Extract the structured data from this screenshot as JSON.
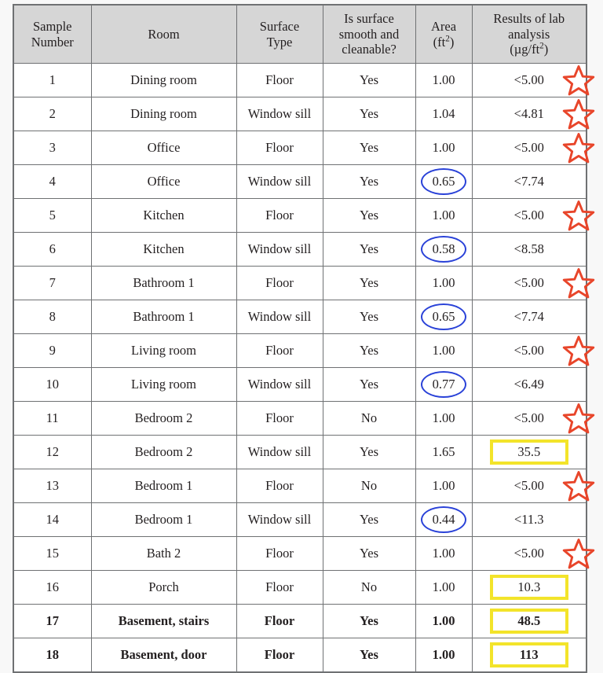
{
  "table": {
    "columns": [
      {
        "key": "sample",
        "label_lines": [
          "Sample",
          "Number"
        ]
      },
      {
        "key": "room",
        "label_lines": [
          "Room"
        ]
      },
      {
        "key": "surface",
        "label_lines": [
          "Surface",
          "Type"
        ]
      },
      {
        "key": "smooth",
        "label_lines": [
          "Is surface",
          "smooth and",
          "cleanable?"
        ]
      },
      {
        "key": "area",
        "label_lines": [
          "Area",
          "(ft2)"
        ],
        "unit_html": "(ft<sup>2</sup>)"
      },
      {
        "key": "lab",
        "label_lines": [
          "Results of lab",
          "analysis",
          "(µg/ft2)"
        ],
        "unit_html": "(µg/ft<sup>2</sup>)"
      }
    ],
    "rows": [
      {
        "sample": "1",
        "room": "Dining room",
        "surface": "Floor",
        "smooth": "Yes",
        "area": "1.00",
        "lab": "<5.00",
        "area_circled": false,
        "lab_boxed": false,
        "lab_starred": true,
        "bold": false
      },
      {
        "sample": "2",
        "room": "Dining room",
        "surface": "Window sill",
        "smooth": "Yes",
        "area": "1.04",
        "lab": "<4.81",
        "area_circled": false,
        "lab_boxed": false,
        "lab_starred": true,
        "bold": false
      },
      {
        "sample": "3",
        "room": "Office",
        "surface": "Floor",
        "smooth": "Yes",
        "area": "1.00",
        "lab": "<5.00",
        "area_circled": false,
        "lab_boxed": false,
        "lab_starred": true,
        "bold": false
      },
      {
        "sample": "4",
        "room": "Office",
        "surface": "Window sill",
        "smooth": "Yes",
        "area": "0.65",
        "lab": "<7.74",
        "area_circled": true,
        "lab_boxed": false,
        "lab_starred": false,
        "bold": false
      },
      {
        "sample": "5",
        "room": "Kitchen",
        "surface": "Floor",
        "smooth": "Yes",
        "area": "1.00",
        "lab": "<5.00",
        "area_circled": false,
        "lab_boxed": false,
        "lab_starred": true,
        "bold": false
      },
      {
        "sample": "6",
        "room": "Kitchen",
        "surface": "Window sill",
        "smooth": "Yes",
        "area": "0.58",
        "lab": "<8.58",
        "area_circled": true,
        "lab_boxed": false,
        "lab_starred": false,
        "bold": false
      },
      {
        "sample": "7",
        "room": "Bathroom 1",
        "surface": "Floor",
        "smooth": "Yes",
        "area": "1.00",
        "lab": "<5.00",
        "area_circled": false,
        "lab_boxed": false,
        "lab_starred": true,
        "bold": false
      },
      {
        "sample": "8",
        "room": "Bathroom 1",
        "surface": "Window sill",
        "smooth": "Yes",
        "area": "0.65",
        "lab": "<7.74",
        "area_circled": true,
        "lab_boxed": false,
        "lab_starred": false,
        "bold": false
      },
      {
        "sample": "9",
        "room": "Living room",
        "surface": "Floor",
        "smooth": "Yes",
        "area": "1.00",
        "lab": "<5.00",
        "area_circled": false,
        "lab_boxed": false,
        "lab_starred": true,
        "bold": false
      },
      {
        "sample": "10",
        "room": "Living room",
        "surface": "Window sill",
        "smooth": "Yes",
        "area": "0.77",
        "lab": "<6.49",
        "area_circled": true,
        "lab_boxed": false,
        "lab_starred": false,
        "bold": false
      },
      {
        "sample": "11",
        "room": "Bedroom 2",
        "surface": "Floor",
        "smooth": "No",
        "area": "1.00",
        "lab": "<5.00",
        "area_circled": false,
        "lab_boxed": false,
        "lab_starred": true,
        "bold": false
      },
      {
        "sample": "12",
        "room": "Bedroom 2",
        "surface": "Window sill",
        "smooth": "Yes",
        "area": "1.65",
        "lab": "35.5",
        "area_circled": false,
        "lab_boxed": true,
        "lab_starred": false,
        "bold": false
      },
      {
        "sample": "13",
        "room": "Bedroom 1",
        "surface": "Floor",
        "smooth": "No",
        "area": "1.00",
        "lab": "<5.00",
        "area_circled": false,
        "lab_boxed": false,
        "lab_starred": true,
        "bold": false
      },
      {
        "sample": "14",
        "room": "Bedroom 1",
        "surface": "Window sill",
        "smooth": "Yes",
        "area": "0.44",
        "lab": "<11.3",
        "area_circled": true,
        "lab_boxed": false,
        "lab_starred": false,
        "bold": false
      },
      {
        "sample": "15",
        "room": "Bath 2",
        "surface": "Floor",
        "smooth": "Yes",
        "area": "1.00",
        "lab": "<5.00",
        "area_circled": false,
        "lab_boxed": false,
        "lab_starred": true,
        "bold": false
      },
      {
        "sample": "16",
        "room": "Porch",
        "surface": "Floor",
        "smooth": "No",
        "area": "1.00",
        "lab": "10.3",
        "area_circled": false,
        "lab_boxed": true,
        "lab_starred": false,
        "bold": false
      },
      {
        "sample": "17",
        "room": "Basement, stairs",
        "surface": "Floor",
        "smooth": "Yes",
        "area": "1.00",
        "lab": "48.5",
        "area_circled": false,
        "lab_boxed": true,
        "lab_starred": false,
        "bold": true
      },
      {
        "sample": "18",
        "room": "Basement, door",
        "surface": "Floor",
        "smooth": "Yes",
        "area": "1.00",
        "lab": "113",
        "area_circled": false,
        "lab_boxed": true,
        "lab_starred": false,
        "bold": true
      }
    ]
  },
  "annotations": {
    "star_icon_name": "red-star-icon",
    "ellipse_icon_name": "blue-ellipse-icon",
    "box_icon_name": "yellow-highlight-box",
    "star_color": "#e8452a",
    "ellipse_color": "#2a42d8",
    "box_color": "#f3e42a"
  },
  "colors": {
    "header_background": "#d6d6d6",
    "border": "#6f7173",
    "page_background": "#f8f8f8",
    "text": "#231f20"
  }
}
